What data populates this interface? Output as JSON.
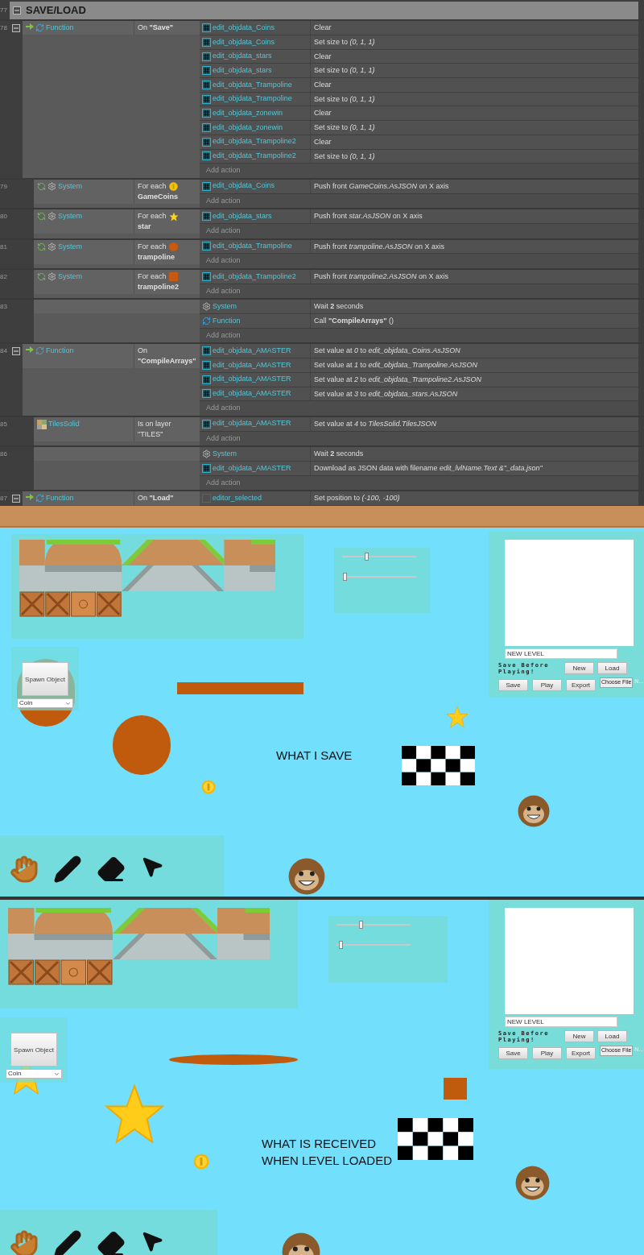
{
  "event_sheet": {
    "group": {
      "line": "77",
      "title": "SAVE/LOAD",
      "expanded": true
    },
    "events": [
      {
        "line": "78",
        "expanded": true,
        "condition": {
          "kind": "trigger",
          "object": "Function",
          "text": [
            "On **\"Save\"**"
          ]
        },
        "actions": [
          {
            "kind": "array",
            "object": "edit_objdata_Coins",
            "text": "Clear"
          },
          {
            "kind": "array",
            "object": "edit_objdata_Coins",
            "text": "Set size to *(0, 1, 1)*"
          },
          {
            "kind": "array",
            "object": "edit_objdata_stars",
            "text": "Clear"
          },
          {
            "kind": "array",
            "object": "edit_objdata_stars",
            "text": "Set size to *(0, 1, 1)*"
          },
          {
            "kind": "array",
            "object": "edit_objdata_Trampoline",
            "text": "Clear"
          },
          {
            "kind": "array",
            "object": "edit_objdata_Trampoline",
            "text": "Set size to *(0, 1, 1)*"
          },
          {
            "kind": "array",
            "object": "edit_objdata_zonewin",
            "text": "Clear"
          },
          {
            "kind": "array",
            "object": "edit_objdata_zonewin",
            "text": "Set size to *(0, 1, 1)*"
          },
          {
            "kind": "array",
            "object": "edit_objdata_Trampoline2",
            "text": "Clear"
          },
          {
            "kind": "array",
            "object": "edit_objdata_Trampoline2",
            "text": "Set size to *(0, 1, 1)*"
          }
        ],
        "add_action": "Add action",
        "children": [
          {
            "line": "79",
            "condition": {
              "kind": "loop",
              "object": "System",
              "text": [
                "For each",
                "**GameCoins**"
              ],
              "param": {
                "kind": "coin"
              }
            },
            "actions": [
              {
                "kind": "array",
                "object": "edit_objdata_Coins",
                "text": "Push front *GameCoins.AsJSON* on X axis"
              }
            ],
            "add_action": "Add action"
          },
          {
            "line": "80",
            "condition": {
              "kind": "loop",
              "object": "System",
              "text": [
                "For each",
                "**star**"
              ],
              "param": {
                "kind": "star"
              }
            },
            "actions": [
              {
                "kind": "array",
                "object": "edit_objdata_stars",
                "text": "Push front *star.AsJSON* on X axis"
              }
            ],
            "add_action": "Add action"
          },
          {
            "line": "81",
            "condition": {
              "kind": "loop",
              "object": "System",
              "text": [
                "For each",
                "**trampoline**"
              ],
              "param": {
                "kind": "circle"
              }
            },
            "actions": [
              {
                "kind": "array",
                "object": "edit_objdata_Trampoline",
                "text": "Push front *trampoline.AsJSON* on X axis"
              }
            ],
            "add_action": "Add action"
          },
          {
            "line": "82",
            "condition": {
              "kind": "loop",
              "object": "System",
              "text": [
                "For each",
                "**trampoline2**"
              ],
              "param": {
                "kind": "square"
              }
            },
            "actions": [
              {
                "kind": "array",
                "object": "edit_objdata_Trampoline2",
                "text": "Push front *trampoline2.AsJSON* on X axis"
              }
            ],
            "add_action": "Add action"
          },
          {
            "line": "83",
            "actions": [
              {
                "kind": "system",
                "object": "System",
                "text": "Wait **2** seconds"
              },
              {
                "kind": "function",
                "object": "Function",
                "text": "Call **\"CompileArrays\"** ()"
              }
            ],
            "add_action": "Add action"
          }
        ]
      },
      {
        "line": "84",
        "expanded": true,
        "condition": {
          "kind": "trigger",
          "object": "Function",
          "text": [
            "On",
            "**\"CompileArrays\"**"
          ]
        },
        "actions": [
          {
            "kind": "array",
            "object": "edit_objdata_AMASTER",
            "text": "Set value at *0* to *edit_objdata_Coins.AsJSON*"
          },
          {
            "kind": "array",
            "object": "edit_objdata_AMASTER",
            "text": "Set value at *1* to *edit_objdata_Trampoline.AsJSON*"
          },
          {
            "kind": "array",
            "object": "edit_objdata_AMASTER",
            "text": "Set value at *2* to *edit_objdata_Trampoline2.AsJSON*"
          },
          {
            "kind": "array",
            "object": "edit_objdata_AMASTER",
            "text": "Set value at *3* to *edit_objdata_stars.AsJSON*"
          }
        ],
        "add_action": "Add action",
        "children": [
          {
            "line": "85",
            "condition": {
              "kind": "tiles",
              "object": "TilesSolid",
              "text": [
                "Is on layer",
                "\"TILES\""
              ]
            },
            "actions": [
              {
                "kind": "array",
                "object": "edit_objdata_AMASTER",
                "text": "Set value at *4* to *TilesSolid.TilesJSON*"
              }
            ],
            "add_action": "Add action"
          },
          {
            "line": "86",
            "actions": [
              {
                "kind": "system",
                "object": "System",
                "text": "Wait **2** seconds"
              },
              {
                "kind": "array",
                "object": "edit_objdata_AMASTER",
                "text": "Download as JSON data with filename *edit_lvlName.Text &\"_data.json\"*"
              }
            ],
            "add_action": "Add action"
          }
        ]
      },
      {
        "line": "87",
        "expanded": true,
        "condition": {
          "kind": "trigger",
          "object": "Function",
          "text": [
            "On **\"Load\"**"
          ]
        },
        "actions": [
          {
            "kind": "sprite",
            "object": "editor_selected",
            "text": "Set position to *(-100, -100)*"
          }
        ]
      }
    ]
  },
  "scenes": [
    {
      "caption": [
        "WHAT I SAVE"
      ],
      "sliders": [
        {
          "level": 0.33
        },
        {
          "level": 0.03
        }
      ],
      "level_name": "NEW LEVEL",
      "hint": "Save Before Playing!",
      "row1_buttons": [
        "New",
        "Load"
      ],
      "row2_buttons": [
        "Save",
        "Play",
        "Export"
      ],
      "file_button": "Choose File",
      "file_status": "N...",
      "spawn_button": "Spawn Object",
      "spawn_select": "Coin"
    },
    {
      "caption": [
        "WHAT IS RECEIVED",
        "WHEN LEVEL LOADED"
      ],
      "sliders": [
        {
          "level": 0.33
        },
        {
          "level": 0.05
        }
      ],
      "level_name": "NEW LEVEL",
      "hint": "Save Before Playing!",
      "row1_buttons": [
        "New",
        "Load"
      ],
      "row2_buttons": [
        "Save",
        "Play",
        "Export"
      ],
      "file_button": "Choose File",
      "file_status": "N...",
      "spawn_button": "Spawn Object",
      "spawn_select": "Coin"
    }
  ]
}
